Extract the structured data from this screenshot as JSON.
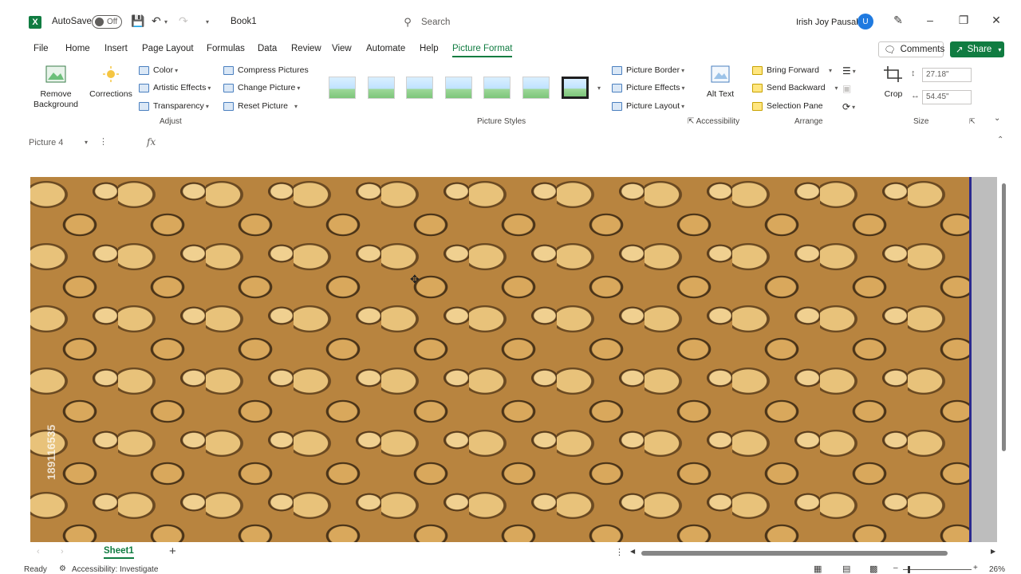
{
  "titlebar": {
    "autosave_label": "AutoSave",
    "autosave_state": "Off",
    "app_icon": "X",
    "book_title": "Book1",
    "search_placeholder": "Search",
    "user_name": "Irish Joy Pausal",
    "avatar_initial": "U"
  },
  "tabs": [
    "File",
    "Home",
    "Insert",
    "Page Layout",
    "Formulas",
    "Data",
    "Review",
    "View",
    "Automate",
    "Help",
    "Picture Format"
  ],
  "active_tab": "Picture Format",
  "actions": {
    "comments": "Comments",
    "share": "Share"
  },
  "ribbon": {
    "adjust": {
      "remove_background": "Remove Background",
      "corrections": "Corrections",
      "color": "Color",
      "artistic_effects": "Artistic Effects",
      "transparency": "Transparency",
      "compress_pictures": "Compress Pictures",
      "change_picture": "Change Picture",
      "reset_picture": "Reset Picture",
      "label": "Adjust"
    },
    "picture_styles": {
      "label": "Picture Styles",
      "thumb_count": 7
    },
    "accessibility": {
      "picture_border": "Picture Border",
      "picture_effects": "Picture Effects",
      "picture_layout": "Picture Layout",
      "alt_text": "Alt Text",
      "label": "Accessibility"
    },
    "arrange": {
      "bring_forward": "Bring Forward",
      "send_backward": "Send Backward",
      "selection_pane": "Selection Pane",
      "label": "Arrange"
    },
    "size": {
      "crop": "Crop",
      "height": "27.18\"",
      "width": "54.45\"",
      "label": "Size"
    }
  },
  "formula_bar": {
    "name_box": "Picture 4",
    "fx": "fx"
  },
  "picture": {
    "watermark": "189116535"
  },
  "sheet": {
    "tab": "Sheet1",
    "add": "+"
  },
  "status": {
    "ready": "Ready",
    "accessibility": "Accessibility: Investigate",
    "zoom": "26%"
  },
  "colors": {
    "accent": "#107c41",
    "share_bg": "#107c41",
    "avatar": "#1f7ae0"
  }
}
